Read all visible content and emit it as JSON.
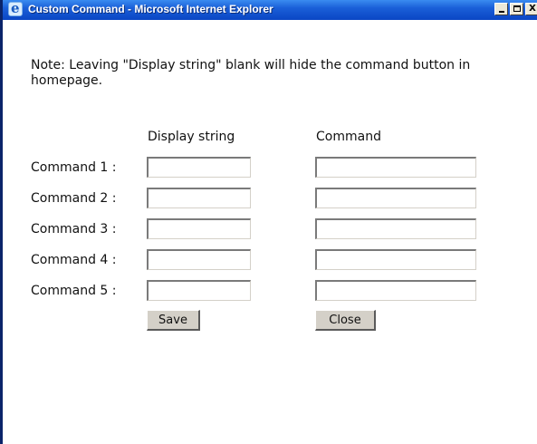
{
  "window": {
    "title": "Custom Command - Microsoft Internet Explorer",
    "controls": {
      "minimize": "_",
      "maximize": "□",
      "close": "X"
    }
  },
  "note": "Note: Leaving \"Display string\" blank will hide the command button in homepage.",
  "columns": {
    "display": "Display string",
    "command": "Command"
  },
  "rows": [
    {
      "label": "Command 1 :",
      "display_value": "",
      "command_value": ""
    },
    {
      "label": "Command 2 :",
      "display_value": "",
      "command_value": ""
    },
    {
      "label": "Command 3 :",
      "display_value": "",
      "command_value": ""
    },
    {
      "label": "Command 4 :",
      "display_value": "",
      "command_value": ""
    },
    {
      "label": "Command 5 :",
      "display_value": "",
      "command_value": ""
    }
  ],
  "buttons": {
    "save": "Save",
    "close": "Close"
  }
}
